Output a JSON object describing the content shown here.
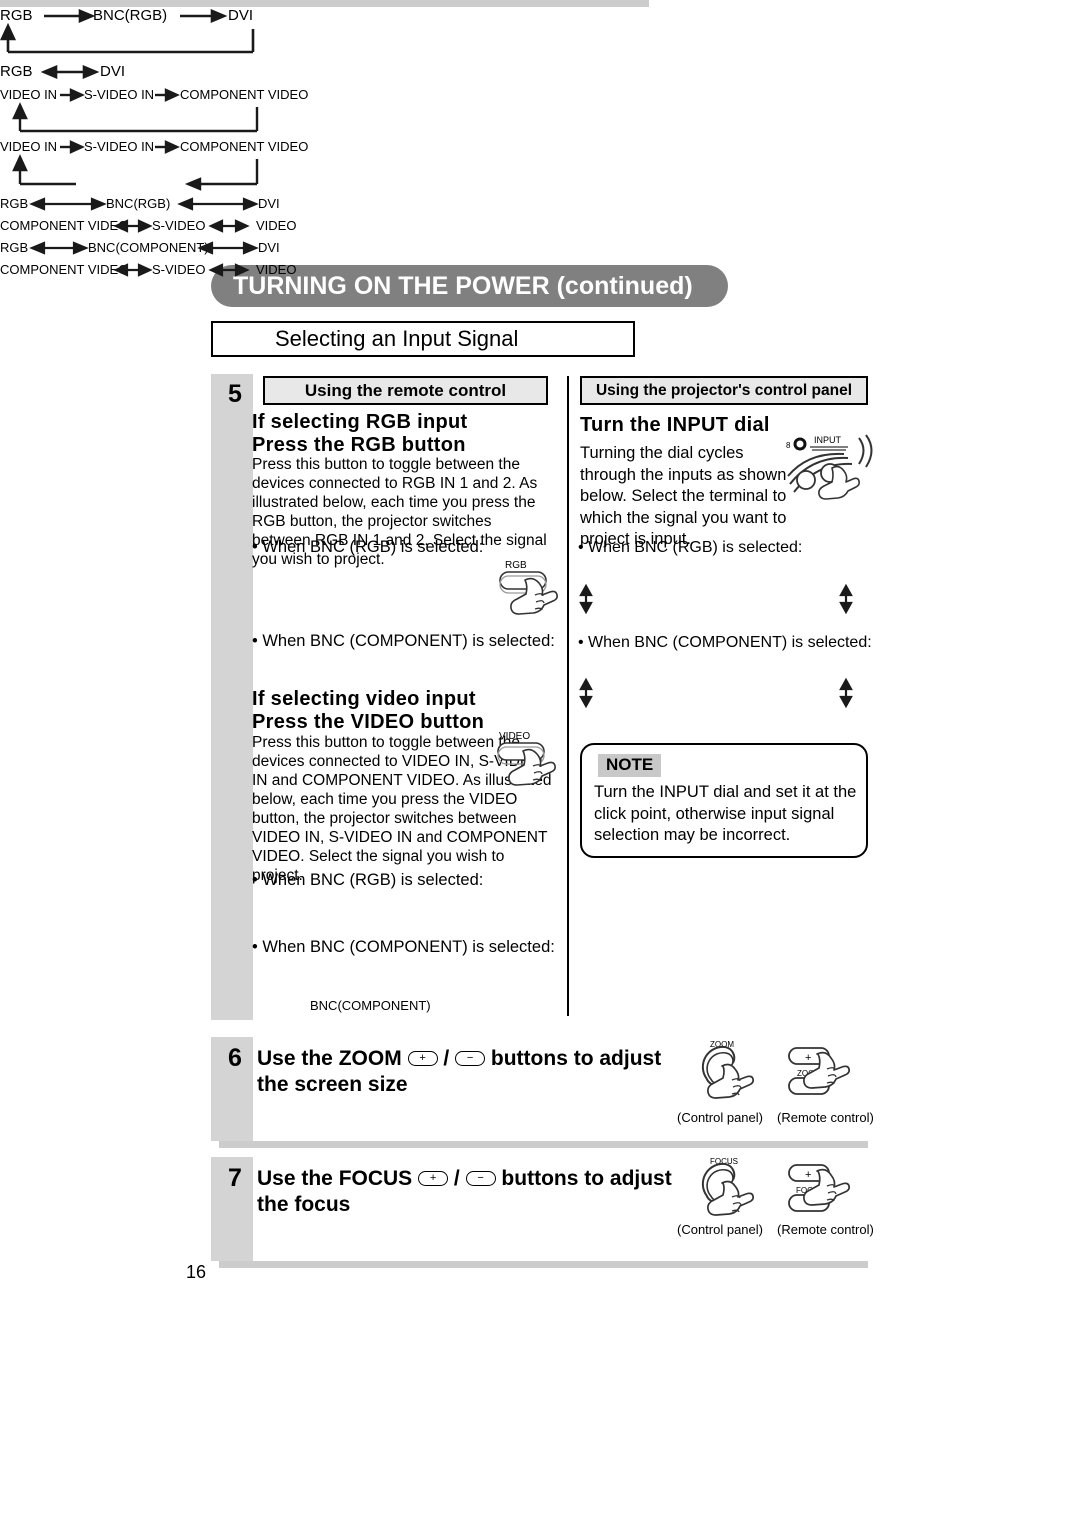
{
  "page": {
    "number": "16",
    "banner_title": "TURNING ON THE POWER (continued)",
    "section_title": "Selecting an Input Signal"
  },
  "colors": {
    "banner_bg": "#808080",
    "step_column_bg": "#d4d4d4",
    "header_bg": "#e8e8e8",
    "note_badge_bg": "#c8c8c8",
    "shadow": "#cccccc"
  },
  "step5": {
    "number": "5",
    "left_column": {
      "header": "Using the remote control",
      "heading1_line1": "If selecting RGB input",
      "heading1_line2": "Press the RGB button",
      "paragraph1": "Press this button to toggle between the devices connected to RGB IN 1 and 2. As illustrated below, each time you press the RGB button, the projector switches between RGB IN 1 and 2. Select the signal you wish to project.",
      "bullet1": "• When BNC (RGB) is selected:",
      "diagram1": {
        "a": "RGB",
        "b": "BNC(RGB)",
        "c": "DVI"
      },
      "bullet2": "• When BNC (COMPONENT) is selected:",
      "diagram2": {
        "a": "RGB",
        "b": "DVI"
      },
      "heading2_line1": "If selecting video input",
      "heading2_line2": "Press the VIDEO button",
      "paragraph2": "Press this button to toggle between the devices connected to VIDEO IN, S-VIDEO IN and COMPONENT VIDEO. As illustrated below, each time you press the VIDEO button, the projector switches between VIDEO IN, S-VIDEO IN and COMPONENT VIDEO. Select the signal you wish to project.",
      "bullet3": "• When BNC (RGB) is selected:",
      "diagram3": {
        "a": "VIDEO IN",
        "b": "S-VIDEO IN",
        "c": "COMPONENT VIDEO"
      },
      "bullet4": "• When BNC (COMPONENT) is selected:",
      "diagram4": {
        "a": "VIDEO IN",
        "b": "S-VIDEO IN",
        "c": "COMPONENT VIDEO",
        "d": "BNC(COMPONENT)"
      },
      "rgb_button_label": "RGB",
      "video_button_label": "VIDEO"
    },
    "right_column": {
      "header": "Using the projector's control panel",
      "heading": "Turn the INPUT dial",
      "paragraph": "Turning the dial cycles through the inputs as shown below. Select the terminal to which the signal you want to project is input.",
      "dial_label": "INPUT",
      "dial_marker": "8",
      "bullet1": "• When BNC (RGB) is selected:",
      "diagram1_top": {
        "a": "RGB",
        "b": "BNC(RGB)",
        "c": "DVI"
      },
      "diagram1_bottom": {
        "a": "COMPONENT VIDEO",
        "b": "S-VIDEO",
        "c": "VIDEO"
      },
      "bullet2": "• When BNC (COMPONENT) is selected:",
      "diagram2_top": {
        "a": "RGB",
        "b": "BNC(COMPONENT)",
        "c": "DVI"
      },
      "diagram2_bottom": {
        "a": "COMPONENT VIDEO",
        "b": "S-VIDEO",
        "c": "VIDEO"
      },
      "note": {
        "badge": "NOTE",
        "text": "Turn the INPUT dial and set it at the click point, otherwise input signal selection may be incorrect."
      }
    }
  },
  "step6": {
    "number": "6",
    "title_prefix": "Use the ZOOM",
    "title_middle": "/",
    "title_suffix": "buttons to adjust",
    "title_line2": "the screen size",
    "plus_label": "+",
    "minus_label": "−",
    "illustration_label": "ZOOM",
    "caption_control_panel": "(Control panel)",
    "caption_remote_control": "(Remote control)"
  },
  "step7": {
    "number": "7",
    "title_prefix": "Use the FOCUS",
    "title_middle": "/",
    "title_suffix": "buttons to adjust",
    "title_line2": "the focus",
    "plus_label": "+",
    "minus_label": "−",
    "illustration_label": "FOCUS",
    "caption_control_panel": "(Control panel)",
    "caption_remote_control": "(Remote control)"
  }
}
